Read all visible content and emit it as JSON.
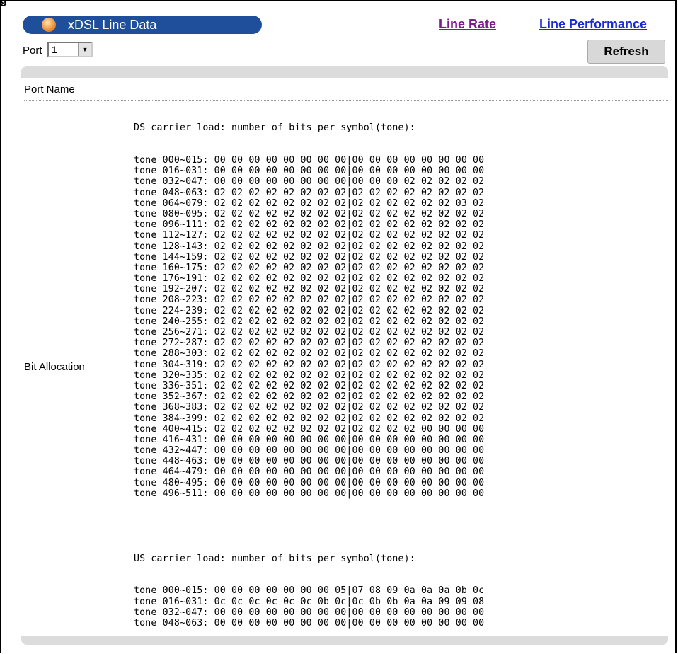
{
  "figure_label": "g",
  "header": {
    "title": "xDSL Line Data",
    "links": [
      "Line Rate",
      "Line Performance"
    ]
  },
  "controls": {
    "port_label": "Port",
    "port_value": "1",
    "refresh_label": "Refresh"
  },
  "rows": {
    "port_name_label": "Port Name",
    "port_name_value": "",
    "bit_allocation_label": "Bit Allocation"
  },
  "bit_allocation": {
    "ds_header": "DS carrier load: number of bits per symbol(tone):",
    "ds_lines": [
      "tone 000~015: 00 00 00 00 00 00 00 00|00 00 00 00 00 00 00 00",
      "tone 016~031: 00 00 00 00 00 00 00 00|00 00 00 00 00 00 00 00",
      "tone 032~047: 00 00 00 00 00 00 00 00|00 00 00 02 02 02 02 02",
      "tone 048~063: 02 02 02 02 02 02 02 02|02 02 02 02 02 02 02 02",
      "tone 064~079: 02 02 02 02 02 02 02 02|02 02 02 02 02 02 03 02",
      "tone 080~095: 02 02 02 02 02 02 02 02|02 02 02 02 02 02 02 02",
      "tone 096~111: 02 02 02 02 02 02 02 02|02 02 02 02 02 02 02 02",
      "tone 112~127: 02 02 02 02 02 02 02 02|02 02 02 02 02 02 02 02",
      "tone 128~143: 02 02 02 02 02 02 02 02|02 02 02 02 02 02 02 02",
      "tone 144~159: 02 02 02 02 02 02 02 02|02 02 02 02 02 02 02 02",
      "tone 160~175: 02 02 02 02 02 02 02 02|02 02 02 02 02 02 02 02",
      "tone 176~191: 02 02 02 02 02 02 02 02|02 02 02 02 02 02 02 02",
      "tone 192~207: 02 02 02 02 02 02 02 02|02 02 02 02 02 02 02 02",
      "tone 208~223: 02 02 02 02 02 02 02 02|02 02 02 02 02 02 02 02",
      "tone 224~239: 02 02 02 02 02 02 02 02|02 02 02 02 02 02 02 02",
      "tone 240~255: 02 02 02 02 02 02 02 02|02 02 02 02 02 02 02 02",
      "tone 256~271: 02 02 02 02 02 02 02 02|02 02 02 02 02 02 02 02",
      "tone 272~287: 02 02 02 02 02 02 02 02|02 02 02 02 02 02 02 02",
      "tone 288~303: 02 02 02 02 02 02 02 02|02 02 02 02 02 02 02 02",
      "tone 304~319: 02 02 02 02 02 02 02 02|02 02 02 02 02 02 02 02",
      "tone 320~335: 02 02 02 02 02 02 02 02|02 02 02 02 02 02 02 02",
      "tone 336~351: 02 02 02 02 02 02 02 02|02 02 02 02 02 02 02 02",
      "tone 352~367: 02 02 02 02 02 02 02 02|02 02 02 02 02 02 02 02",
      "tone 368~383: 02 02 02 02 02 02 02 02|02 02 02 02 02 02 02 02",
      "tone 384~399: 02 02 02 02 02 02 02 02|02 02 02 02 02 02 02 02",
      "tone 400~415: 02 02 02 02 02 02 02 02|02 02 02 02 00 00 00 00",
      "tone 416~431: 00 00 00 00 00 00 00 00|00 00 00 00 00 00 00 00",
      "tone 432~447: 00 00 00 00 00 00 00 00|00 00 00 00 00 00 00 00",
      "tone 448~463: 00 00 00 00 00 00 00 00|00 00 00 00 00 00 00 00",
      "tone 464~479: 00 00 00 00 00 00 00 00|00 00 00 00 00 00 00 00",
      "tone 480~495: 00 00 00 00 00 00 00 00|00 00 00 00 00 00 00 00",
      "tone 496~511: 00 00 00 00 00 00 00 00|00 00 00 00 00 00 00 00"
    ],
    "us_header": "US carrier load: number of bits per symbol(tone):",
    "us_lines": [
      "tone 000~015: 00 00 00 00 00 00 00 05|07 08 09 0a 0a 0a 0b 0c",
      "tone 016~031: 0c 0c 0c 0c 0c 0c 0b 0c|0c 0b 0b 0a 0a 09 09 08",
      "tone 032~047: 00 00 00 00 00 00 00 00|00 00 00 00 00 00 00 00",
      "tone 048~063: 00 00 00 00 00 00 00 00|00 00 00 00 00 00 00 00"
    ]
  }
}
